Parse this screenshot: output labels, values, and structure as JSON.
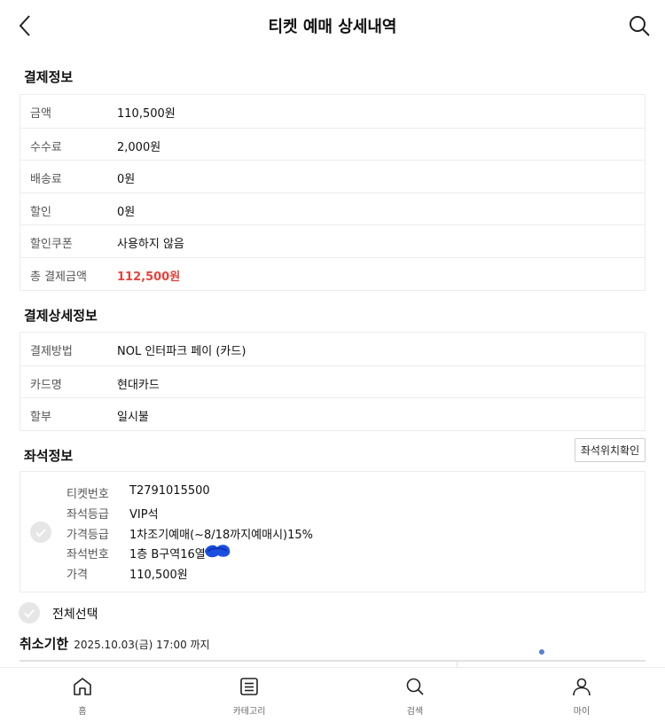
{
  "header": {
    "title": "티켓 예매 상세내역",
    "back_icon": "chevron-left-icon",
    "search_icon": "search-icon"
  },
  "payment_info": {
    "title": "결제정보",
    "rows": [
      {
        "label": "금액",
        "value": "110,500원"
      },
      {
        "label": "수수료",
        "value": "2,000원"
      },
      {
        "label": "배송료",
        "value": "0원"
      },
      {
        "label": "할인",
        "value": "0원"
      },
      {
        "label": "할인쿠폰",
        "value": "사용하지 않음"
      },
      {
        "label": "총 결제금액",
        "value": "112,500원"
      }
    ],
    "total_color": "#e0463b"
  },
  "payment_detail": {
    "title": "결제상세정보",
    "rows": [
      {
        "label": "결제방법",
        "value": "NOL 인터파크 페이 (카드)"
      },
      {
        "label": "카드명",
        "value": "현대카드"
      },
      {
        "label": "할부",
        "value": "일시불"
      }
    ]
  },
  "seat_info": {
    "title": "좌석정보",
    "seat_location_button": "좌석위치확인",
    "rows": [
      {
        "label": "티켓번호",
        "value": "T2791015500"
      },
      {
        "label": "좌석등급",
        "value": "VIP석"
      },
      {
        "label": "가격등급",
        "value": "1차조기예매(~8/18까지예매시)15%"
      },
      {
        "label": "좌석번호",
        "value": "1층 B구역16열"
      },
      {
        "label": "가격",
        "value": "110,500원"
      }
    ],
    "redaction_color": "#1a4fe0"
  },
  "select_all_label": "전체선택",
  "cancel_deadline": {
    "label": "취소기한",
    "value": "2025.10.03(금) 17:00 까지"
  },
  "tabbar": {
    "items": [
      {
        "label": "홈",
        "icon": "home-icon"
      },
      {
        "label": "카테고리",
        "icon": "category-list-icon"
      },
      {
        "label": "검색",
        "icon": "search-icon"
      },
      {
        "label": "마이",
        "icon": "user-icon"
      }
    ]
  }
}
